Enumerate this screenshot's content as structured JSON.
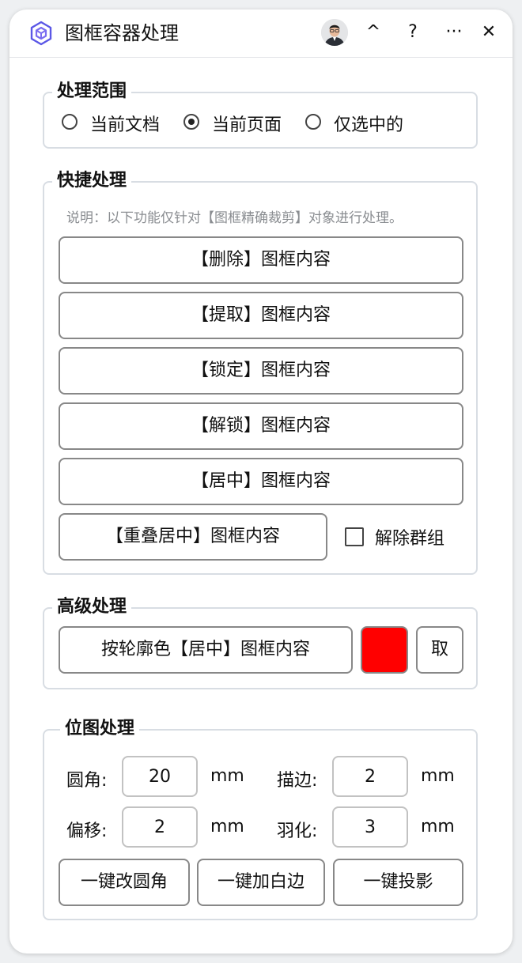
{
  "app": {
    "title": "图框容器处理"
  },
  "title_buttons": {
    "collapse": "^",
    "help": "?",
    "more": "···",
    "close": "✕"
  },
  "scope": {
    "title": "处理范围",
    "options": [
      {
        "label": "当前文档",
        "checked": false
      },
      {
        "label": "当前页面",
        "checked": true
      },
      {
        "label": "仅选中的",
        "checked": false
      }
    ]
  },
  "quick": {
    "title": "快捷处理",
    "note": "说明：以下功能仅针对【图框精确裁剪】对象进行处理。",
    "buttons": [
      "【删除】图框内容",
      "【提取】图框内容",
      "【锁定】图框内容",
      "【解锁】图框内容",
      "【居中】图框内容"
    ],
    "overlap_button": "【重叠居中】图框内容",
    "ungroup_label": "解除群组",
    "ungroup_checked": false
  },
  "advanced": {
    "title": "高级处理",
    "outline_button": "按轮廓色【居中】图框内容",
    "swatch_color": "#ff0000",
    "pick_button": "取"
  },
  "bitmap": {
    "title": "位图处理",
    "corner_label": "圆角:",
    "corner_value": "20",
    "corner_unit": "mm",
    "stroke_label": "描边:",
    "stroke_value": "2",
    "stroke_unit": "mm",
    "offset_label": "偏移:",
    "offset_value": "2",
    "offset_unit": "mm",
    "feather_label": "羽化:",
    "feather_value": "3",
    "feather_unit": "mm",
    "round_button": "一键改圆角",
    "white_border_button": "一键加白边",
    "shadow_button": "一键投影"
  },
  "colors": {
    "accent": "#5b57e6",
    "border": "#d8dde3"
  }
}
